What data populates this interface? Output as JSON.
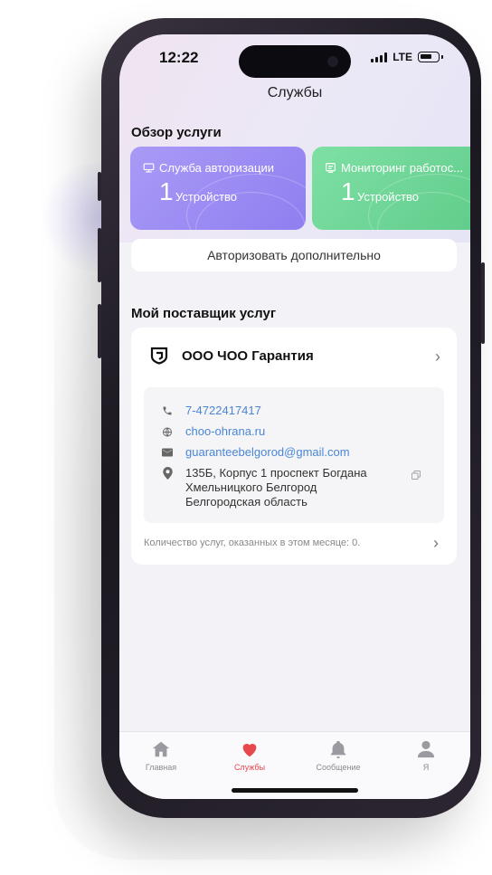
{
  "status_bar": {
    "time": "12:22",
    "network": "LTE"
  },
  "header": {
    "title": "Службы"
  },
  "overview": {
    "heading": "Обзор услуги",
    "cards": [
      {
        "title": "Служба авторизации",
        "count": "1",
        "unit": "Устройство",
        "color": "#9b8cf4"
      },
      {
        "title": "Мониторинг работос...",
        "count": "1",
        "unit": "Устройство",
        "color": "#6fd796"
      }
    ],
    "authorize_more": "Авторизовать дополнительно"
  },
  "provider": {
    "heading": "Мой поставщик услуг",
    "name": "ООО ЧОО Гарантия",
    "phone": "7-4722417417",
    "website": "choo-ohrana.ru",
    "email": "guaranteebelgorod@gmail.com",
    "address": "135Б, Корпус 1 проспект Богдана Хмельницкого Белгород Белгородская область",
    "services_this_month": "Количество услуг, оказанных в этом месяце: 0."
  },
  "tabbar": {
    "tabs": [
      {
        "label": "Главная",
        "icon": "home-icon",
        "active": false
      },
      {
        "label": "Службы",
        "icon": "heart-icon",
        "active": true
      },
      {
        "label": "Сообщение",
        "icon": "bell-icon",
        "active": false
      },
      {
        "label": "Я",
        "icon": "person-icon",
        "active": false
      }
    ]
  },
  "colors": {
    "accent": "#e8474b",
    "link": "#4a86d6"
  }
}
